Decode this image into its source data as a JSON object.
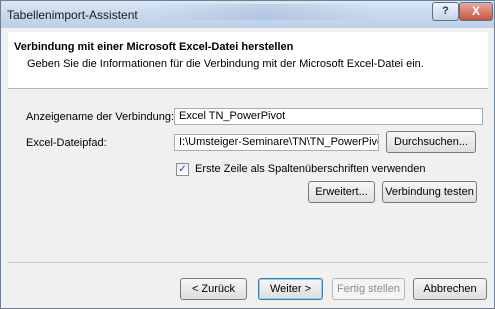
{
  "window": {
    "title": "Tabellenimport-Assistent",
    "help_label": "?",
    "close_label": "X"
  },
  "header": {
    "title": "Verbindung mit einer Microsoft Excel-Datei herstellen",
    "subtitle": "Geben Sie die Informationen für die Verbindung mit der Microsoft Excel-Datei ein."
  },
  "form": {
    "connection_name_label": "Anzeigename der Verbindung:",
    "connection_name_value": "Excel TN_PowerPivot",
    "file_path_label": "Excel-Dateipfad:",
    "file_path_value": "I:\\Umsteiger-Seminare\\TN\\TN_PowerPivot.x",
    "browse_label": "Durchsuchen...",
    "first_row_header_label": "Erste Zeile als Spaltenüberschriften verwenden",
    "first_row_header_checked": true,
    "advanced_label": "Erweitert...",
    "test_connection_label": "Verbindung testen"
  },
  "footer": {
    "back_label": "< Zurück",
    "next_label": "Weiter >",
    "finish_label": "Fertig stellen",
    "cancel_label": "Abbrechen"
  }
}
